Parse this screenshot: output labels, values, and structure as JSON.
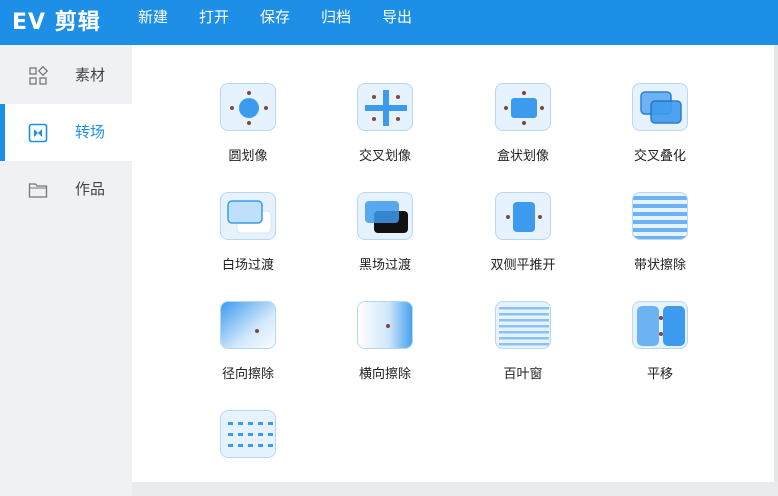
{
  "app": {
    "title": "EV 剪辑"
  },
  "menu": [
    "新建",
    "打开",
    "保存",
    "归档",
    "导出"
  ],
  "sidebar": {
    "items": [
      {
        "label": "素材",
        "icon": "grid-icon",
        "active": false
      },
      {
        "label": "转场",
        "icon": "transition-icon",
        "active": true
      },
      {
        "label": "作品",
        "icon": "folder-icon",
        "active": false
      }
    ]
  },
  "transitions": [
    {
      "label": "圆划像",
      "icon": "circle-wipe-icon"
    },
    {
      "label": "交叉划像",
      "icon": "cross-wipe-icon"
    },
    {
      "label": "盒状划像",
      "icon": "box-wipe-icon"
    },
    {
      "label": "交叉叠化",
      "icon": "cross-dissolve-icon"
    },
    {
      "label": "白场过渡",
      "icon": "fade-white-icon"
    },
    {
      "label": "黑场过渡",
      "icon": "fade-black-icon"
    },
    {
      "label": "双侧平推开",
      "icon": "double-push-icon"
    },
    {
      "label": "带状擦除",
      "icon": "band-wipe-icon"
    },
    {
      "label": "径向擦除",
      "icon": "radial-wipe-icon"
    },
    {
      "label": "横向擦除",
      "icon": "horizontal-wipe-icon"
    },
    {
      "label": "百叶窗",
      "icon": "blinds-icon"
    },
    {
      "label": "平移",
      "icon": "slide-icon"
    },
    {
      "label": "",
      "icon": "dots-grid-icon"
    }
  ],
  "colors": {
    "accent": "#1e8fe6",
    "sidebar_bg": "#f0f1f4",
    "thumb_bg": "#e6f2fd",
    "shape": "#3d9bef"
  }
}
